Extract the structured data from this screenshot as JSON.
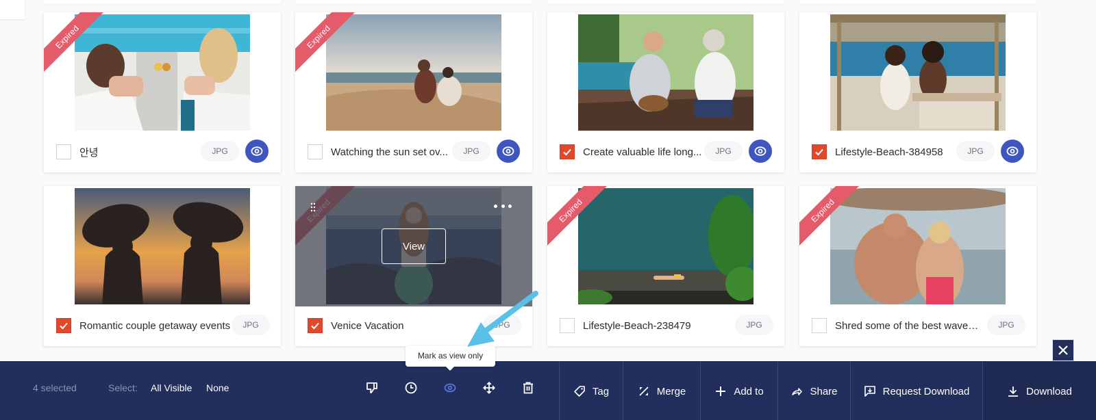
{
  "colors": {
    "ribbon": "#e45b69",
    "checkbox_checked": "#e2492c",
    "eye_button": "#3f55c0",
    "action_bar": "#222e5c",
    "active_tool": "#5b73d6",
    "arrow": "#5bc0e8"
  },
  "assets": [
    {
      "title": "안녕",
      "format": "JPG",
      "checked": false,
      "expired": true,
      "eye": true,
      "scene": "pool"
    },
    {
      "title": "Watching the sun set ov...",
      "format": "JPG",
      "checked": false,
      "expired": true,
      "eye": true,
      "scene": "beach-sunset"
    },
    {
      "title": "Create valuable life long...",
      "format": "JPG",
      "checked": true,
      "expired": false,
      "eye": true,
      "scene": "elderly-couple"
    },
    {
      "title": "Lifestyle-Beach-384958",
      "format": "JPG",
      "checked": true,
      "expired": false,
      "eye": true,
      "scene": "beach-table"
    },
    {
      "title": "Romantic couple getaway events",
      "format": "JPG",
      "checked": true,
      "expired": false,
      "eye": false,
      "scene": "surf-silhouette"
    },
    {
      "title": "Venice Vacation",
      "format": "JPG",
      "checked": true,
      "expired": true,
      "eye": false,
      "scene": "venice",
      "hovered": true
    },
    {
      "title": "Lifestyle-Beach-238479",
      "format": "JPG",
      "checked": false,
      "expired": true,
      "eye": false,
      "scene": "pool-aerial"
    },
    {
      "title": "Shred some of the best waves ...",
      "format": "JPG",
      "checked": false,
      "expired": true,
      "eye": false,
      "scene": "surfers"
    }
  ],
  "labels": {
    "expired": "Expired",
    "view": "View"
  },
  "action_bar": {
    "selected_count": "4 selected",
    "select_label": "Select:",
    "select_all": "All Visible",
    "select_none": "None",
    "tools": [
      {
        "name": "dislike",
        "icon": "thumbs-down-icon"
      },
      {
        "name": "expiration",
        "icon": "clock-icon"
      },
      {
        "name": "view-only",
        "icon": "eye-icon",
        "active": true
      },
      {
        "name": "move",
        "icon": "move-icon"
      },
      {
        "name": "delete",
        "icon": "trash-icon"
      }
    ],
    "tooltip": "Mark as view only",
    "actions": {
      "tag": "Tag",
      "merge": "Merge",
      "add_to": "Add to",
      "share": "Share",
      "request_download": "Request Download",
      "download": "Download"
    }
  }
}
